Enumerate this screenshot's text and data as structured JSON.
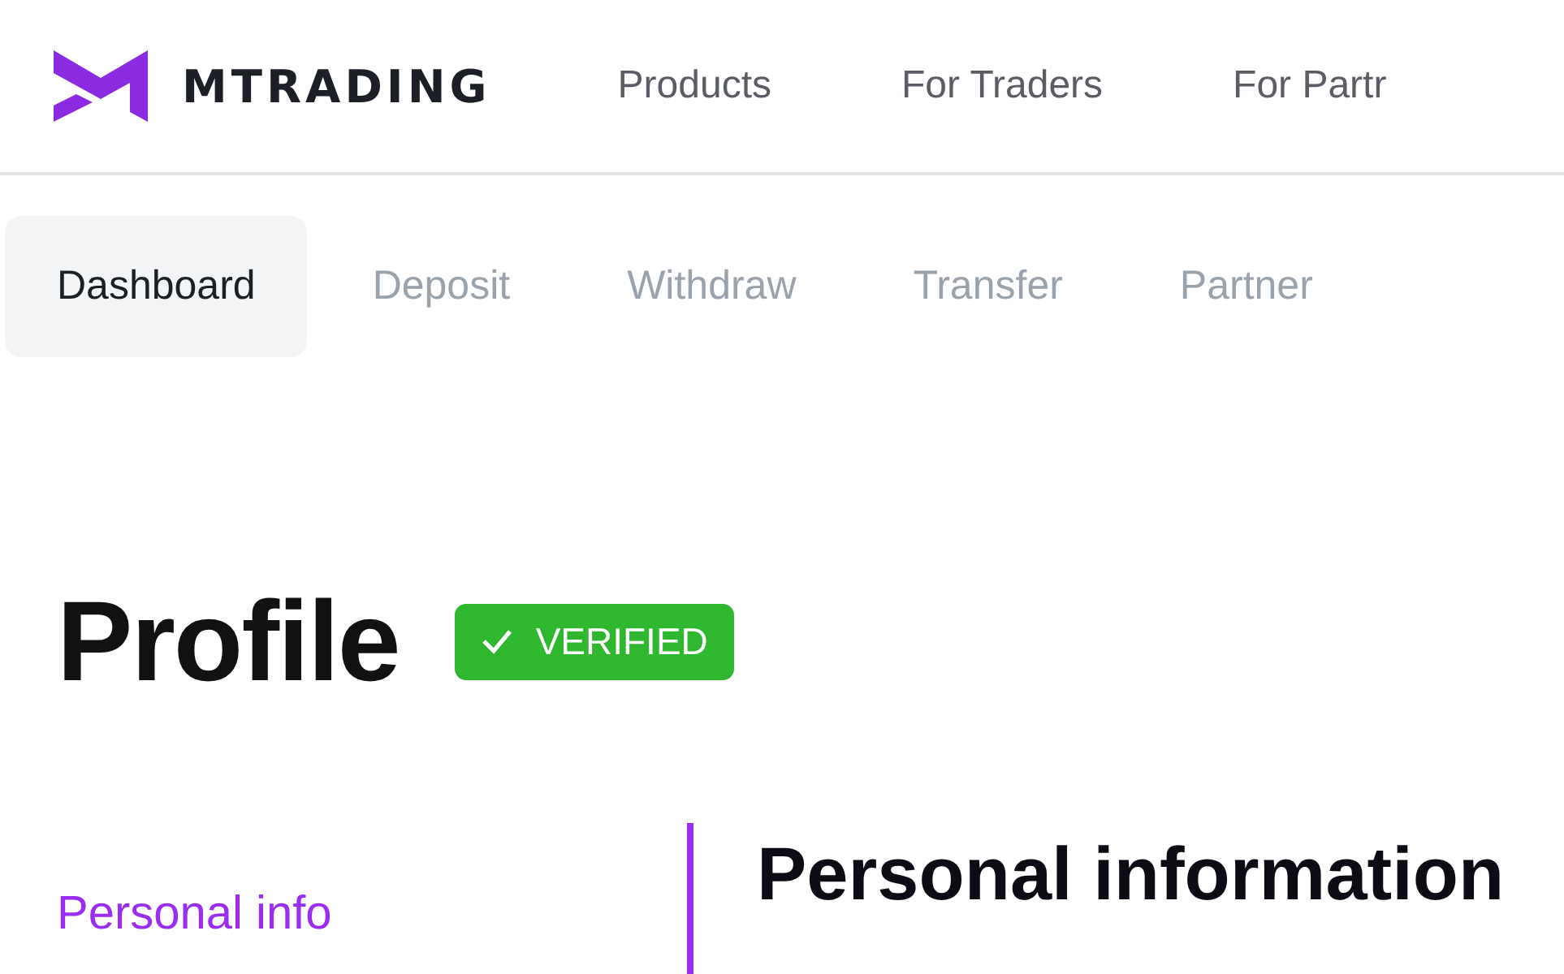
{
  "header": {
    "brand": "MTRADING",
    "nav": [
      "Products",
      "For Traders",
      "For Partr"
    ]
  },
  "tabs": [
    {
      "label": "Dashboard",
      "selected": true
    },
    {
      "label": "Deposit",
      "selected": false
    },
    {
      "label": "Withdraw",
      "selected": false
    },
    {
      "label": "Transfer",
      "selected": false
    },
    {
      "label": "Partner",
      "selected": false
    }
  ],
  "page": {
    "title": "Profile",
    "badge": "VERIFIED",
    "verified": true
  },
  "sidebar": {
    "items": [
      {
        "label": "Personal info",
        "selected": true
      }
    ]
  },
  "section": {
    "title": "Personal information"
  }
}
